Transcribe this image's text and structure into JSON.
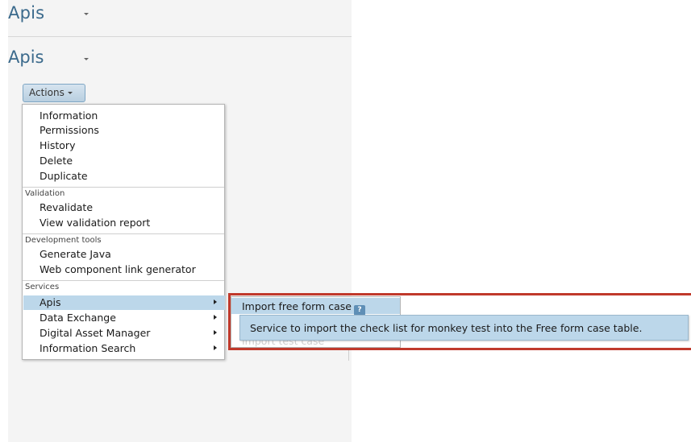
{
  "header": {
    "app_title": "Apis"
  },
  "page": {
    "title": "Apis"
  },
  "actions_button": {
    "label": "Actions"
  },
  "menu": {
    "general_items": [
      "Information",
      "Permissions",
      "History",
      "Delete",
      "Duplicate"
    ],
    "sections": [
      {
        "label": "Validation",
        "items": [
          "Revalidate",
          "View validation report"
        ]
      },
      {
        "label": "Development tools",
        "items": [
          "Generate Java",
          "Web component link generator"
        ]
      },
      {
        "label": "Services",
        "items": [
          "Apis",
          "Data Exchange",
          "Digital Asset Manager",
          "Information Search"
        ]
      }
    ]
  },
  "flyout": {
    "item": "Import free form case",
    "help_icon": "?",
    "second_item": "Import test case"
  },
  "tooltip": {
    "text": "Service to import the check list for monkey test into the Free form case table."
  },
  "colors": {
    "accent": "#3b6a8c",
    "highlight": "#bcd7ea",
    "annotation": "#c0392b"
  }
}
